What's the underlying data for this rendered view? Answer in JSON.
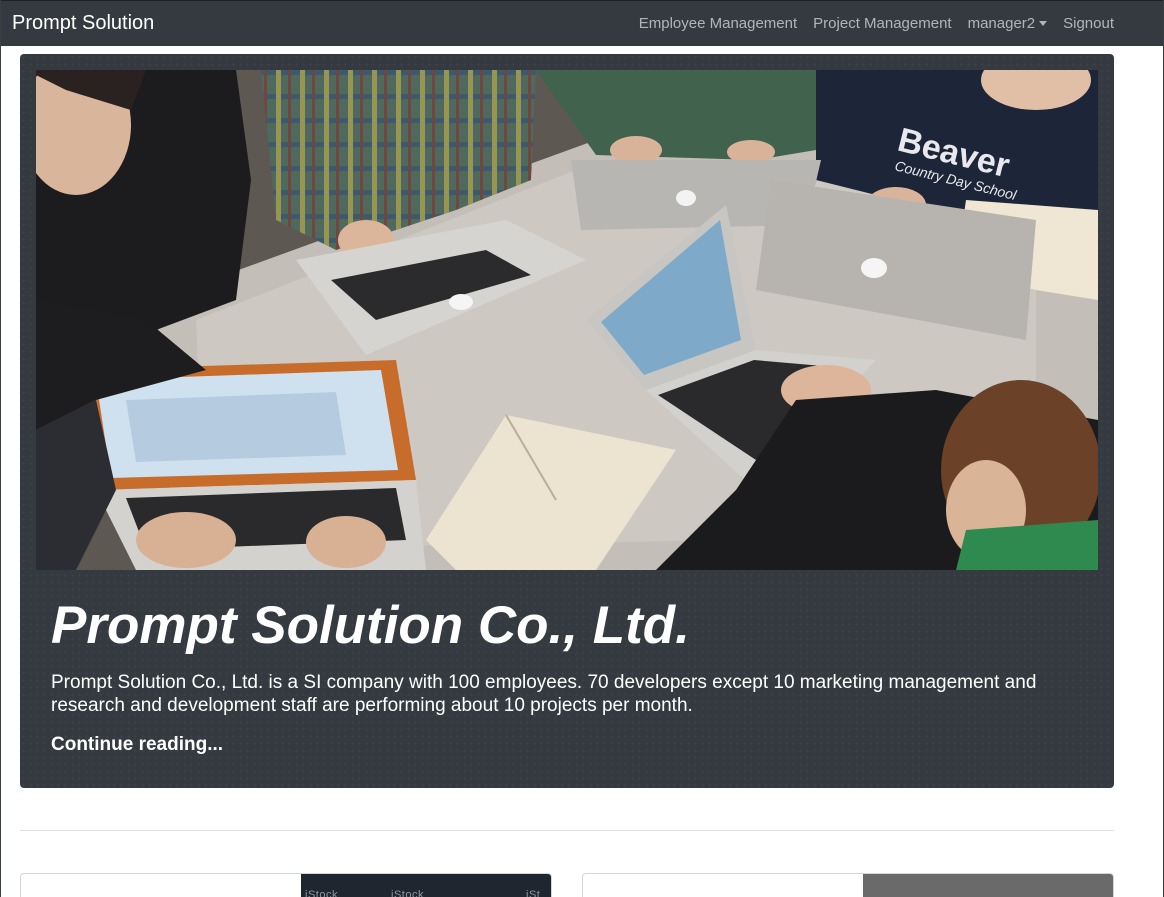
{
  "navbar": {
    "brand": "Prompt Solution",
    "links": [
      {
        "label": "Employee Management"
      },
      {
        "label": "Project Management"
      },
      {
        "label": "manager2",
        "dropdown": true
      },
      {
        "label": "Signout"
      }
    ]
  },
  "hero": {
    "image_alt": "Students working on laptops around a table",
    "image_text": {
      "sweatshirt_line1": "Beaver",
      "sweatshirt_line2": "Country Day School"
    },
    "title": "Prompt Solution Co., Ltd.",
    "description": "Prompt Solution Co., Ltd. is a SI company with 100 employees. 70 developers except 10 marketing management and research and development staff are performing about 10 projects per month.",
    "link_label": "Continue reading..."
  },
  "cards": [
    {
      "thumb_watermark": [
        "iStock",
        "iStock",
        "iSt"
      ]
    },
    {
      "thumb_watermark": []
    }
  ],
  "colors": {
    "navbar_bg": "#343a40",
    "hero_bg": "#343a40",
    "nav_link": "rgba(255,255,255,0.62)"
  }
}
